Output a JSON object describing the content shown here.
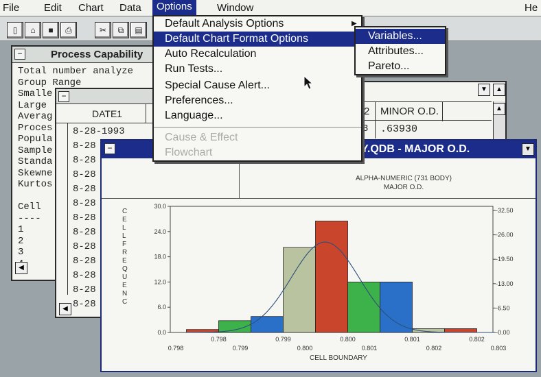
{
  "menubar": {
    "items": [
      "File",
      "Edit",
      "Chart",
      "Data",
      "Options",
      "Window"
    ],
    "right_text": "He"
  },
  "options_menu": {
    "items": [
      {
        "label": "Default Analysis Options",
        "state": "normal",
        "submenu": true
      },
      {
        "label": "Default Chart Format Options",
        "state": "selected",
        "submenu": false
      },
      {
        "label": "Auto Recalculation",
        "state": "normal",
        "submenu": false
      },
      {
        "label": "Run Tests...",
        "state": "normal",
        "submenu": false
      },
      {
        "label": "Special Cause Alert...",
        "state": "normal",
        "submenu": false
      },
      {
        "label": "Preferences...",
        "state": "normal",
        "submenu": false
      },
      {
        "label": "Language...",
        "state": "normal",
        "submenu": false
      },
      {
        "label": "Cause & Effect",
        "state": "disabled",
        "submenu": false
      },
      {
        "label": "Flowchart",
        "state": "disabled",
        "submenu": false
      }
    ]
  },
  "sub_menu": {
    "items": [
      {
        "label": "Variables...",
        "state": "selected"
      },
      {
        "label": "Attributes...",
        "state": "normal"
      },
      {
        "label": "Pareto...",
        "state": "normal"
      }
    ]
  },
  "process_window": {
    "title": "Process Capability",
    "lines": [
      "Total number analyze",
      "Group Range",
      "Smalle",
      "Large",
      "Averag",
      "Proces",
      "Popula",
      "Sample",
      "Standa",
      "Skewne",
      "Kurtos",
      "",
      "Cell",
      "----",
      "1",
      "2",
      "3",
      "4"
    ]
  },
  "date_window": {
    "header": "DATE1",
    "rows": [
      "8-28-1993",
      "8-28",
      "8-28",
      "8-28",
      "8-28",
      "8-28",
      "8-28",
      "8-28",
      "8-28",
      "8-28",
      "8-28",
      "8-28",
      "8-28"
    ]
  },
  "data_window": {
    "col_num": "2",
    "col_header": "MINOR O.D.",
    "row_num": "3",
    "row_value": ".63930"
  },
  "chart_window": {
    "title": "Y.QDB - MAJOR O.D."
  },
  "chart_data": {
    "type": "bar",
    "title": "ALPHA-NUMERIC (731 BODY)",
    "subtitle": "MAJOR O.D.",
    "xlabel": "CELL BOUNDARY",
    "ylabel": "CELL FREQUENC",
    "ylim": [
      0,
      30
    ],
    "y_ticks": [
      "0.0",
      "6.0",
      "12.0",
      "18.0",
      "24.0",
      "30.0"
    ],
    "y2_ticks": [
      "-0.00",
      "-6.50",
      "-13.00",
      "-19.50",
      "-26.00",
      "-32.50"
    ],
    "x_ticks_upper": [
      "0.798",
      "0.799",
      "0.800",
      "0.801",
      "0.802"
    ],
    "x_ticks_lower": [
      "0.798",
      "0.799",
      "0.800",
      "0.801",
      "0.802",
      "0.803"
    ],
    "bins": [
      {
        "value": 0.7,
        "color": "#c9462c"
      },
      {
        "value": 2.8,
        "color": "#3db14a"
      },
      {
        "value": 3.8,
        "color": "#2a70c8"
      },
      {
        "value": 20.2,
        "color": "#b9c3a0"
      },
      {
        "value": 26.5,
        "color": "#c9462c"
      },
      {
        "value": 12.0,
        "color": "#3db14a"
      },
      {
        "value": 12.0,
        "color": "#2a70c8"
      },
      {
        "value": 0.9,
        "color": "#b9c3a0"
      },
      {
        "value": 0.9,
        "color": "#c9462c"
      }
    ],
    "curve": {
      "mean_bin": 3.8,
      "sd_bins": 1.05,
      "peak": 21.5
    },
    "grid": false,
    "legend": "none"
  }
}
